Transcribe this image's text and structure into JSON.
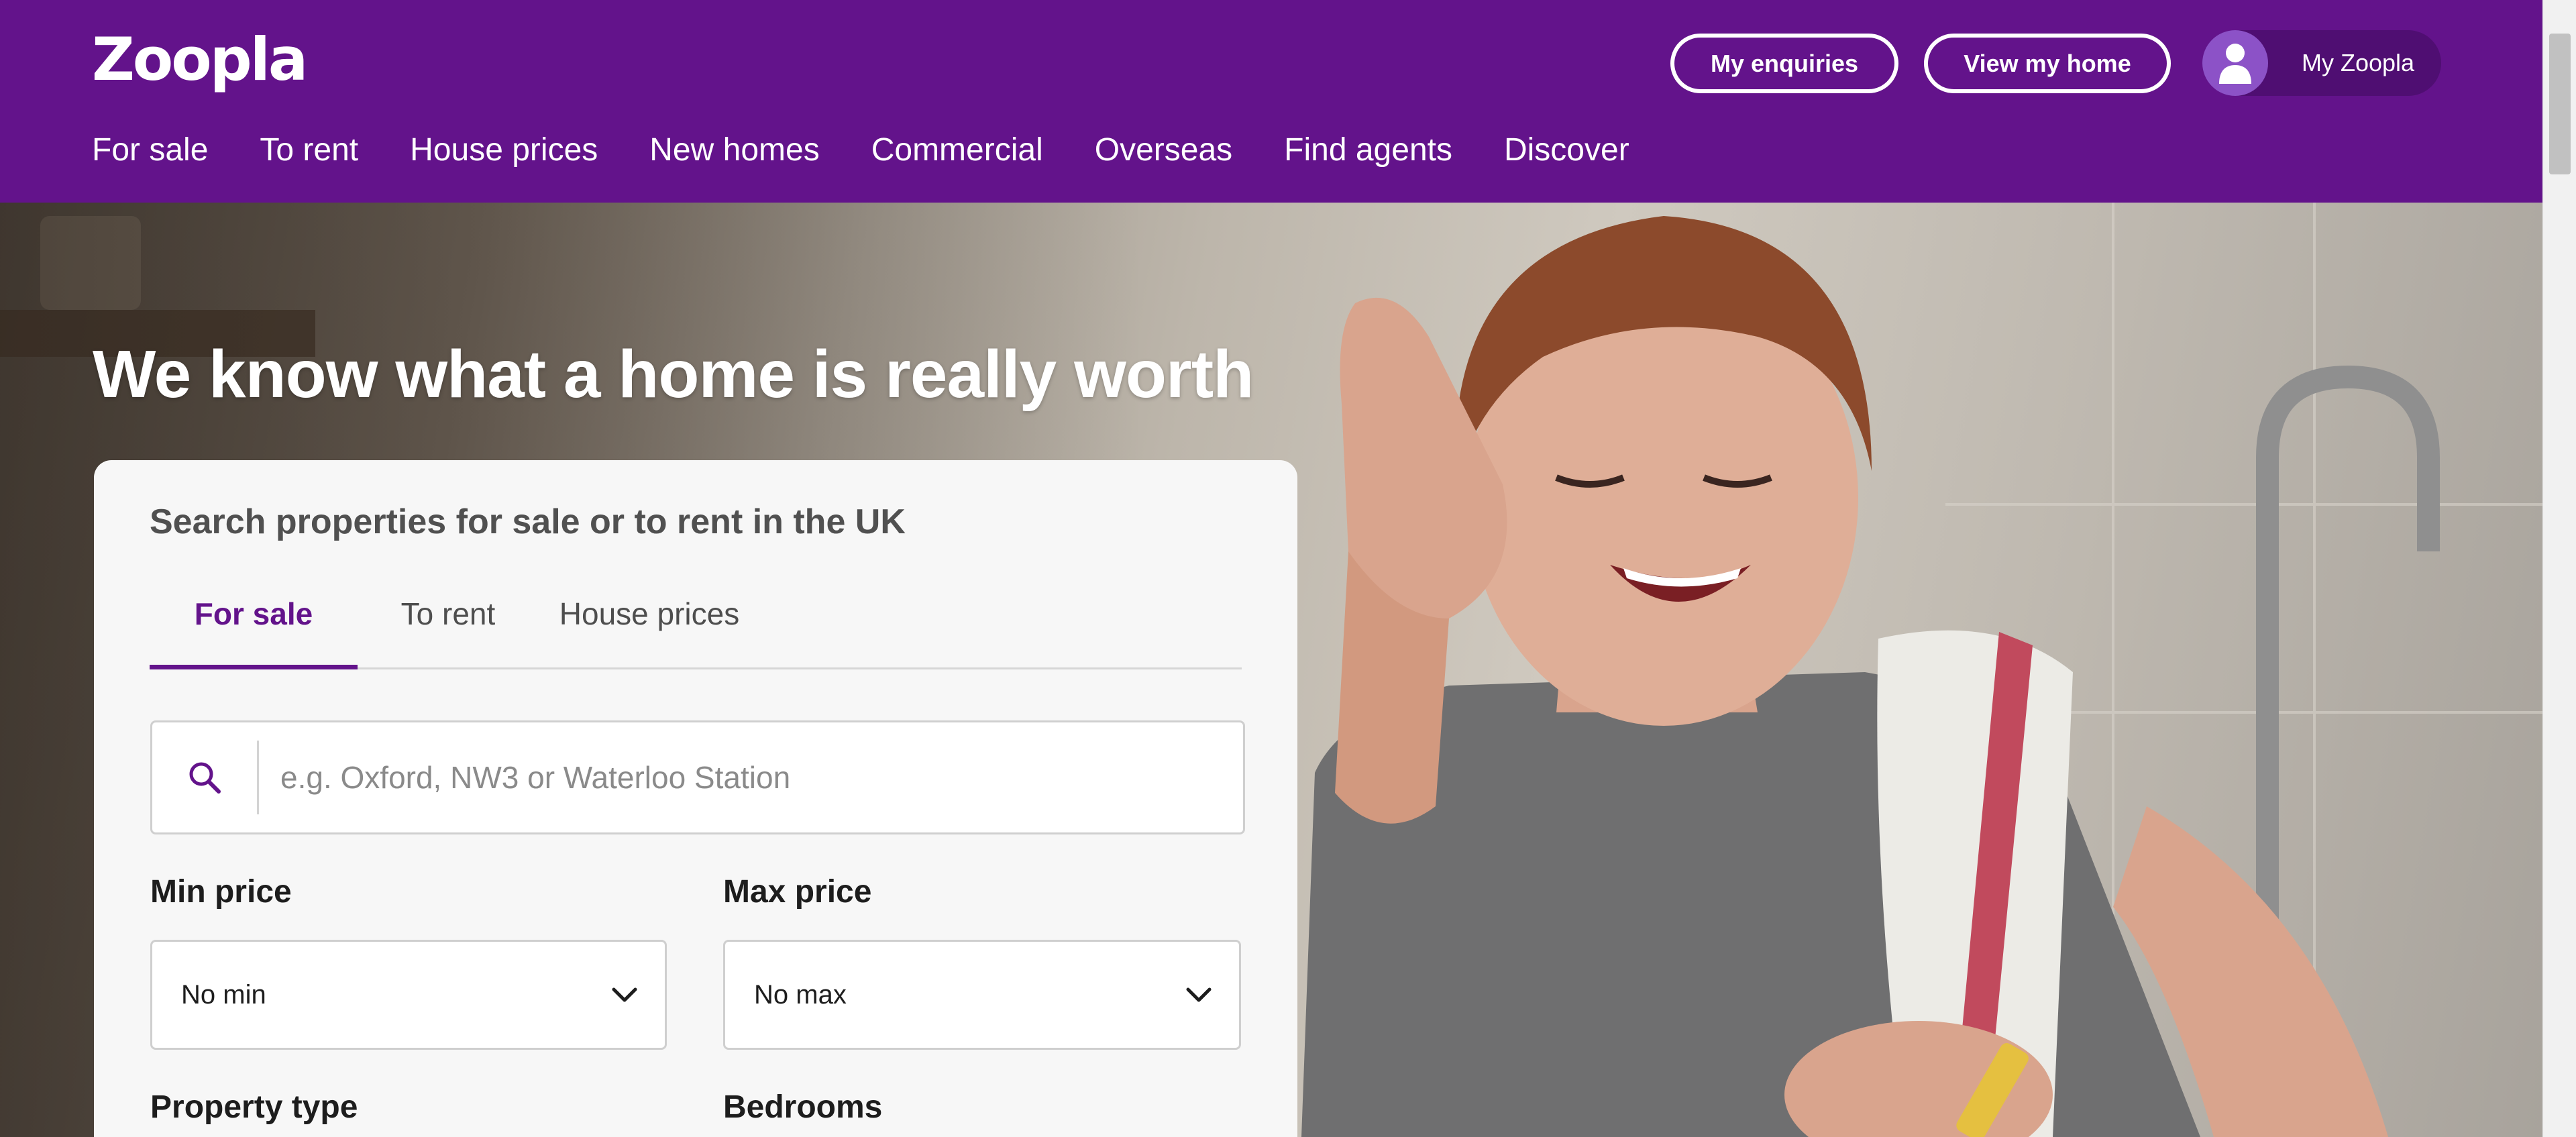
{
  "header": {
    "logo": "Zoopla",
    "buttons": {
      "enquiries": "My enquiries",
      "view_home": "View my home",
      "my_zoopla": "My Zoopla"
    },
    "nav": [
      "For sale",
      "To rent",
      "House prices",
      "New homes",
      "Commercial",
      "Overseas",
      "Find agents",
      "Discover"
    ]
  },
  "hero": {
    "title": "We know what a home is really worth"
  },
  "search": {
    "title": "Search properties for sale or to rent in the UK",
    "tabs": [
      "For sale",
      "To rent",
      "House prices"
    ],
    "active_tab": "For sale",
    "input_placeholder": "e.g. Oxford, NW3 or Waterloo Station",
    "min_price_label": "Min price",
    "min_price_value": "No min",
    "max_price_label": "Max price",
    "max_price_value": "No max",
    "property_type_label": "Property type",
    "bedrooms_label": "Bedrooms"
  },
  "colors": {
    "brand_purple": "#63138b",
    "header_pill": "#4f0e72",
    "avatar": "#8c52c7"
  },
  "icons": {
    "search": "search-icon",
    "dropdown": "chevron-down-icon",
    "avatar": "user-icon"
  }
}
